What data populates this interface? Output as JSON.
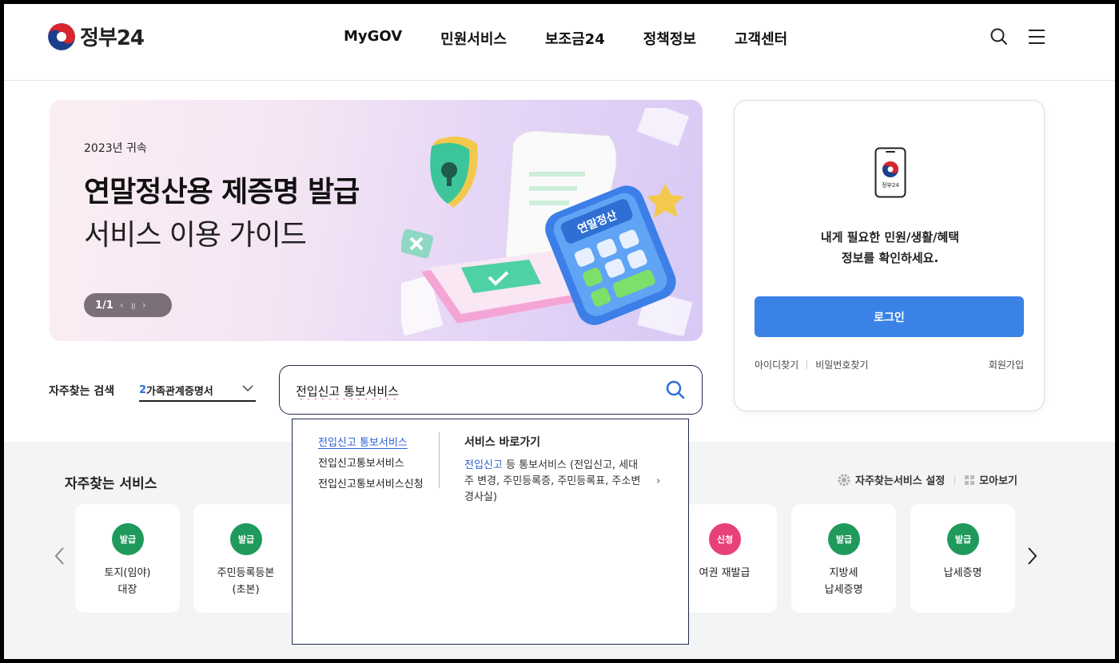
{
  "header": {
    "logo_text": "정부24",
    "nav": [
      "MyGOV",
      "민원서비스",
      "보조금24",
      "정책정보",
      "고객센터"
    ],
    "icons": [
      "search-icon",
      "menu-icon"
    ]
  },
  "banner": {
    "year": "2023년 귀속",
    "title": "연말정산용 제증명 발급",
    "subtitle": "서비스 이용 가이드",
    "pager": "1/1",
    "calc_label": "연말정산"
  },
  "login": {
    "phone_label": "정부24",
    "message_line1": "내게 필요한 민원/생활/혜택",
    "message_line2": "정보를 확인하세요.",
    "login_button": "로그인",
    "find_id": "아이디찾기",
    "find_pw": "비밀번호찾기",
    "signup": "회원가입"
  },
  "search": {
    "frequent_label": "자주찾는 검색",
    "select_num": "2",
    "select_text": "가족관계증명서",
    "query": "전입신고 통보서비스"
  },
  "autocomplete": {
    "suggestions": [
      "전입신고 통보서비스",
      "전입신고통보서비스",
      "전입신고통보서비스신청"
    ],
    "shortcut_title": "서비스 바로가기",
    "shortcut_highlight": "전입신고",
    "shortcut_rest": " 등 통보서비스 (전입신고, 세대주 변경, 주민등록증, 주민등록표, 주소변경사실)",
    "shortcut_arrow": "›"
  },
  "frequent_services": {
    "title": "자주찾는 서비스",
    "settings": "자주찾는서비스 설정",
    "view_all": "모아보기",
    "cards": [
      {
        "badge": "발급",
        "line1": "토지(임야)",
        "line2": "대장",
        "color": "#1f9a5c"
      },
      {
        "badge": "발급",
        "line1": "주민등록등본",
        "line2": "(초본)",
        "color": "#1f9a5c"
      },
      {
        "badge": "신청",
        "line1": "여권 재발급",
        "line2": "",
        "color": "#e8407a"
      },
      {
        "badge": "발급",
        "line1": "지방세",
        "line2": "납세증명",
        "color": "#1f9a5c"
      },
      {
        "badge": "발급",
        "line1": "납세증명",
        "line2": "",
        "color": "#1f9a5c"
      }
    ]
  },
  "colors": {
    "primary": "#3a82e6",
    "issue_green": "#1f9a5c",
    "apply_pink": "#e8407a",
    "link_blue": "#2b5fd6"
  }
}
